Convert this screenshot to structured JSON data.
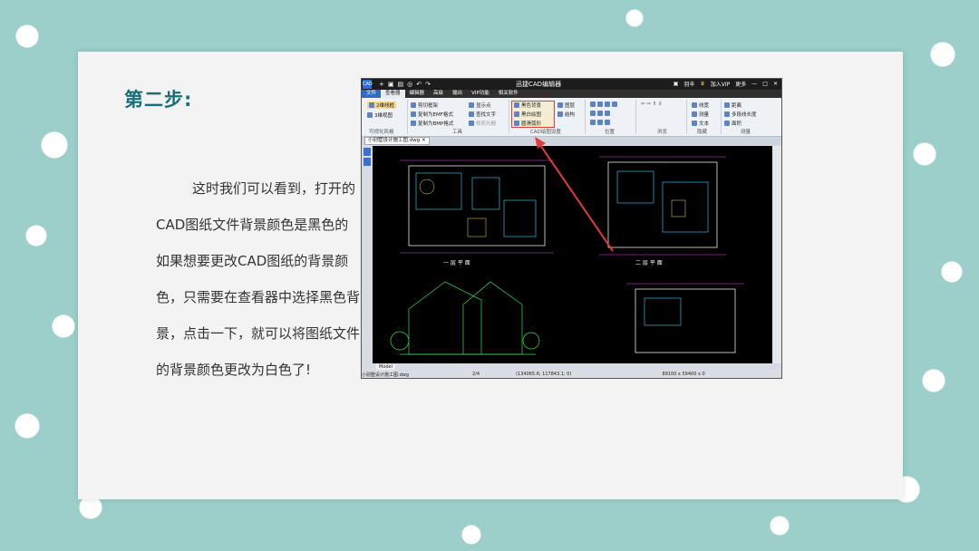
{
  "slide": {
    "step_title": "第二步:",
    "paragraph_lines": [
      "这时我们可以看到，打开的",
      "CAD图纸文件背景颜色是黑色的",
      "如果想要更改CAD图纸的背景颜",
      "色，只需要在查看器中选择黑色背",
      "景，点击一下，就可以将图纸文件",
      "的背景颜色更改为白色了!"
    ]
  },
  "cad_window": {
    "title": "迅捷CAD编辑器",
    "user": "羽辛",
    "join_vip": "加入VIP",
    "more": "更多",
    "menu": [
      "文件",
      "查看器",
      "编辑器",
      "高级",
      "输出",
      "VIP功能",
      "相关软件"
    ],
    "ribbon": {
      "visual_style": {
        "items": [
          "2维线框",
          "3维视图"
        ],
        "label": "可视化风格"
      },
      "tools": {
        "items": [
          "剪切框架",
          "复制为EMF格式",
          "复制为BMP格式",
          "显示点",
          "查找文字",
          "修剪光栅"
        ],
        "label": "工具"
      },
      "cad_settings": {
        "items": [
          "黑色背景",
          "黑白绘图",
          "圆滑弧形",
          "图层",
          "结构"
        ],
        "label": "CAD绘图设置"
      },
      "position_label": "位置",
      "browse_label": "浏览",
      "hide": {
        "items": [
          "线宽",
          "测量",
          "文本"
        ],
        "label": "隐藏"
      },
      "measure": {
        "items": [
          "距离",
          "多段线长度",
          "面积"
        ],
        "label": "测量"
      }
    },
    "doc_tab": "小别墅设计施工图.dwg",
    "drawing_labels": {
      "floor1": "一 层 平 面",
      "floor2": "二 层 平 面"
    },
    "model_tab": "Model",
    "status": {
      "file": "小别墅设计施工图.dwg",
      "page": "2/4",
      "coords": "(134065.6; 117843.1; 0)",
      "size": "89100 x 59400 x 0"
    }
  },
  "colors": {
    "accent": "#17707a",
    "highlight": "#e23b3b",
    "arrow": "#e23b3b"
  }
}
